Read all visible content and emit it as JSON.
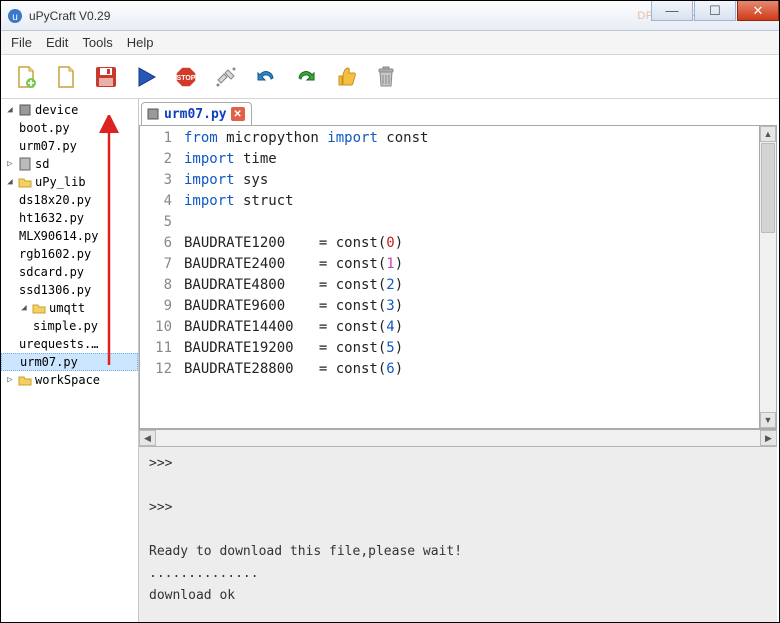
{
  "window": {
    "title": "uPyCraft V0.29",
    "watermark": "DF创客社区"
  },
  "menu": {
    "file": "File",
    "edit": "Edit",
    "tools": "Tools",
    "help": "Help"
  },
  "toolbar": {
    "new": "new-file",
    "open": "open-file",
    "save": "save",
    "run": "run",
    "stop": "stop",
    "connect": "connect",
    "undo": "undo",
    "redo": "redo",
    "like": "like",
    "trash": "trash"
  },
  "tree": {
    "device": {
      "label": "device",
      "children": [
        "boot.py",
        "urm07.py"
      ]
    },
    "sd": {
      "label": "sd"
    },
    "upylib": {
      "label": "uPy_lib",
      "children": [
        "ds18x20.py",
        "ht1632.py",
        "MLX90614.py",
        "rgb1602.py",
        "sdcard.py",
        "ssd1306.py"
      ]
    },
    "umqtt": {
      "label": "umqtt",
      "children": [
        "simple.py"
      ]
    },
    "urequests": "urequests.…",
    "urm07": "urm07.py",
    "workspace": {
      "label": "workSpace"
    }
  },
  "tab": {
    "label": "urm07.py"
  },
  "code": {
    "lines": [
      {
        "n": 1,
        "t": [
          [
            "kw",
            "from"
          ],
          [
            "",
            " micropython "
          ],
          [
            "kw",
            "import"
          ],
          [
            "",
            " const"
          ]
        ]
      },
      {
        "n": 2,
        "t": [
          [
            "kw",
            "import"
          ],
          [
            "",
            " time"
          ]
        ]
      },
      {
        "n": 3,
        "t": [
          [
            "kw",
            "import"
          ],
          [
            "",
            " sys"
          ]
        ]
      },
      {
        "n": 4,
        "t": [
          [
            "kw",
            "import"
          ],
          [
            "",
            " struct"
          ]
        ]
      },
      {
        "n": 5,
        "t": [
          [
            "",
            ""
          ]
        ]
      },
      {
        "n": 6,
        "t": [
          [
            "",
            "BAUDRATE1200    = const("
          ],
          [
            "num-red",
            "0"
          ],
          [
            "",
            ")"
          ]
        ]
      },
      {
        "n": 7,
        "t": [
          [
            "",
            "BAUDRATE2400    = const("
          ],
          [
            "num-pink",
            "1"
          ],
          [
            "",
            ")"
          ]
        ]
      },
      {
        "n": 8,
        "t": [
          [
            "",
            "BAUDRATE4800    = const("
          ],
          [
            "num-blue",
            "2"
          ],
          [
            "",
            ")"
          ]
        ]
      },
      {
        "n": 9,
        "t": [
          [
            "",
            "BAUDRATE9600    = const("
          ],
          [
            "num-blue",
            "3"
          ],
          [
            "",
            ")"
          ]
        ]
      },
      {
        "n": 10,
        "t": [
          [
            "",
            "BAUDRATE14400   = const("
          ],
          [
            "num-blue",
            "4"
          ],
          [
            "",
            ")"
          ]
        ]
      },
      {
        "n": 11,
        "t": [
          [
            "",
            "BAUDRATE19200   = const("
          ],
          [
            "num-blue",
            "5"
          ],
          [
            "",
            ")"
          ]
        ]
      },
      {
        "n": 12,
        "t": [
          [
            "",
            "BAUDRATE28800   = const("
          ],
          [
            "num-blue",
            "6"
          ],
          [
            "",
            ")"
          ]
        ]
      }
    ]
  },
  "console": {
    "l1": ">>>",
    "l2": ">>>",
    "l3": "Ready to download this file,please wait!",
    "l4": "..............",
    "l5": "download ok"
  }
}
